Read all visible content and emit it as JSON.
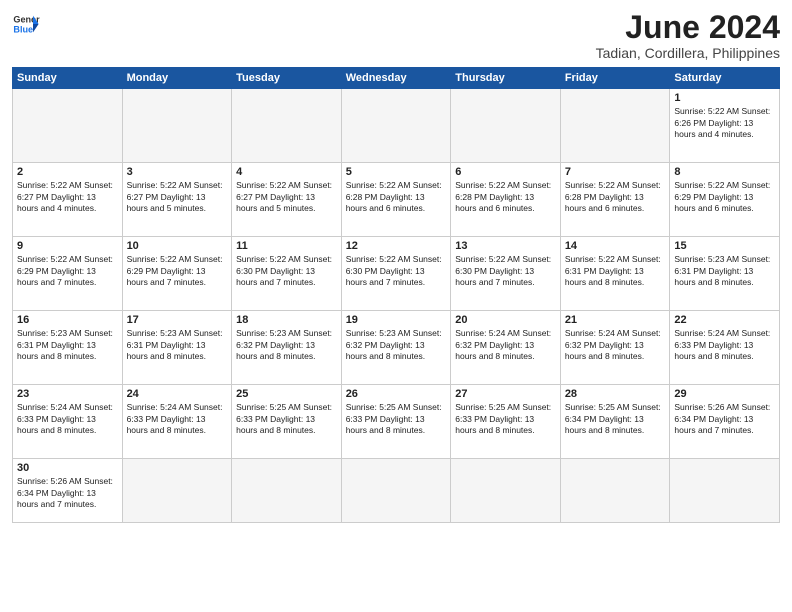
{
  "header": {
    "logo_general": "General",
    "logo_blue": "Blue",
    "month_year": "June 2024",
    "location": "Tadian, Cordillera, Philippines"
  },
  "days_of_week": [
    "Sunday",
    "Monday",
    "Tuesday",
    "Wednesday",
    "Thursday",
    "Friday",
    "Saturday"
  ],
  "weeks": [
    [
      {
        "day": "",
        "info": ""
      },
      {
        "day": "",
        "info": ""
      },
      {
        "day": "",
        "info": ""
      },
      {
        "day": "",
        "info": ""
      },
      {
        "day": "",
        "info": ""
      },
      {
        "day": "",
        "info": ""
      },
      {
        "day": "1",
        "info": "Sunrise: 5:22 AM\nSunset: 6:26 PM\nDaylight: 13 hours and 4 minutes."
      }
    ],
    [
      {
        "day": "2",
        "info": "Sunrise: 5:22 AM\nSunset: 6:27 PM\nDaylight: 13 hours and 4 minutes."
      },
      {
        "day": "3",
        "info": "Sunrise: 5:22 AM\nSunset: 6:27 PM\nDaylight: 13 hours and 5 minutes."
      },
      {
        "day": "4",
        "info": "Sunrise: 5:22 AM\nSunset: 6:27 PM\nDaylight: 13 hours and 5 minutes."
      },
      {
        "day": "5",
        "info": "Sunrise: 5:22 AM\nSunset: 6:28 PM\nDaylight: 13 hours and 6 minutes."
      },
      {
        "day": "6",
        "info": "Sunrise: 5:22 AM\nSunset: 6:28 PM\nDaylight: 13 hours and 6 minutes."
      },
      {
        "day": "7",
        "info": "Sunrise: 5:22 AM\nSunset: 6:28 PM\nDaylight: 13 hours and 6 minutes."
      },
      {
        "day": "8",
        "info": "Sunrise: 5:22 AM\nSunset: 6:29 PM\nDaylight: 13 hours and 6 minutes."
      }
    ],
    [
      {
        "day": "9",
        "info": "Sunrise: 5:22 AM\nSunset: 6:29 PM\nDaylight: 13 hours and 7 minutes."
      },
      {
        "day": "10",
        "info": "Sunrise: 5:22 AM\nSunset: 6:29 PM\nDaylight: 13 hours and 7 minutes."
      },
      {
        "day": "11",
        "info": "Sunrise: 5:22 AM\nSunset: 6:30 PM\nDaylight: 13 hours and 7 minutes."
      },
      {
        "day": "12",
        "info": "Sunrise: 5:22 AM\nSunset: 6:30 PM\nDaylight: 13 hours and 7 minutes."
      },
      {
        "day": "13",
        "info": "Sunrise: 5:22 AM\nSunset: 6:30 PM\nDaylight: 13 hours and 7 minutes."
      },
      {
        "day": "14",
        "info": "Sunrise: 5:22 AM\nSunset: 6:31 PM\nDaylight: 13 hours and 8 minutes."
      },
      {
        "day": "15",
        "info": "Sunrise: 5:23 AM\nSunset: 6:31 PM\nDaylight: 13 hours and 8 minutes."
      }
    ],
    [
      {
        "day": "16",
        "info": "Sunrise: 5:23 AM\nSunset: 6:31 PM\nDaylight: 13 hours and 8 minutes."
      },
      {
        "day": "17",
        "info": "Sunrise: 5:23 AM\nSunset: 6:31 PM\nDaylight: 13 hours and 8 minutes."
      },
      {
        "day": "18",
        "info": "Sunrise: 5:23 AM\nSunset: 6:32 PM\nDaylight: 13 hours and 8 minutes."
      },
      {
        "day": "19",
        "info": "Sunrise: 5:23 AM\nSunset: 6:32 PM\nDaylight: 13 hours and 8 minutes."
      },
      {
        "day": "20",
        "info": "Sunrise: 5:24 AM\nSunset: 6:32 PM\nDaylight: 13 hours and 8 minutes."
      },
      {
        "day": "21",
        "info": "Sunrise: 5:24 AM\nSunset: 6:32 PM\nDaylight: 13 hours and 8 minutes."
      },
      {
        "day": "22",
        "info": "Sunrise: 5:24 AM\nSunset: 6:33 PM\nDaylight: 13 hours and 8 minutes."
      }
    ],
    [
      {
        "day": "23",
        "info": "Sunrise: 5:24 AM\nSunset: 6:33 PM\nDaylight: 13 hours and 8 minutes."
      },
      {
        "day": "24",
        "info": "Sunrise: 5:24 AM\nSunset: 6:33 PM\nDaylight: 13 hours and 8 minutes."
      },
      {
        "day": "25",
        "info": "Sunrise: 5:25 AM\nSunset: 6:33 PM\nDaylight: 13 hours and 8 minutes."
      },
      {
        "day": "26",
        "info": "Sunrise: 5:25 AM\nSunset: 6:33 PM\nDaylight: 13 hours and 8 minutes."
      },
      {
        "day": "27",
        "info": "Sunrise: 5:25 AM\nSunset: 6:33 PM\nDaylight: 13 hours and 8 minutes."
      },
      {
        "day": "28",
        "info": "Sunrise: 5:25 AM\nSunset: 6:34 PM\nDaylight: 13 hours and 8 minutes."
      },
      {
        "day": "29",
        "info": "Sunrise: 5:26 AM\nSunset: 6:34 PM\nDaylight: 13 hours and 7 minutes."
      }
    ],
    [
      {
        "day": "30",
        "info": "Sunrise: 5:26 AM\nSunset: 6:34 PM\nDaylight: 13 hours and 7 minutes."
      },
      {
        "day": "",
        "info": ""
      },
      {
        "day": "",
        "info": ""
      },
      {
        "day": "",
        "info": ""
      },
      {
        "day": "",
        "info": ""
      },
      {
        "day": "",
        "info": ""
      },
      {
        "day": "",
        "info": ""
      }
    ]
  ]
}
